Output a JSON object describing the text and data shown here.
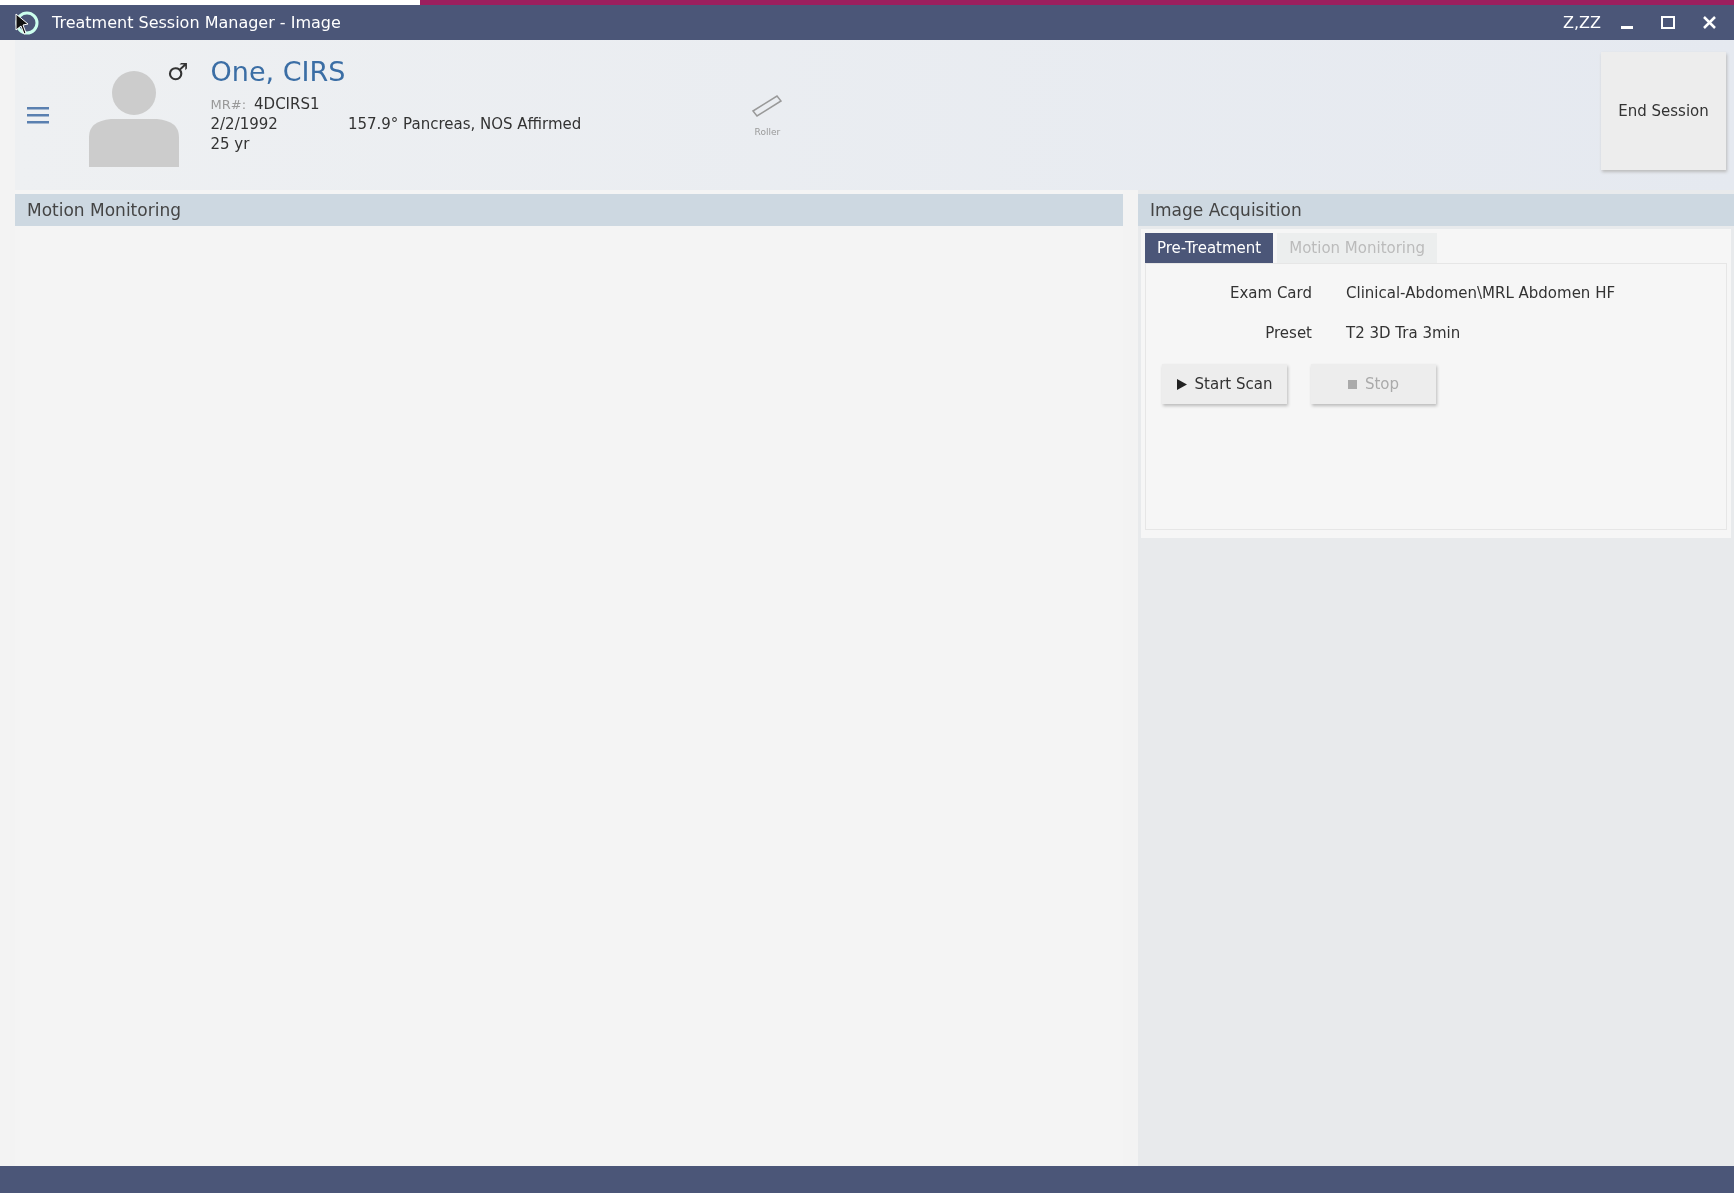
{
  "window": {
    "title": "Treatment Session Manager - Image",
    "user": "Z,ZZ"
  },
  "patient": {
    "sex_symbol": "♂",
    "name": "One, CIRS",
    "mr_label": "MR#:",
    "mr": "4DCIRS1",
    "dob": "2/2/1992",
    "age": "25 yr",
    "treatment": "157.9° Pancreas, NOS Affirmed"
  },
  "tool": {
    "label": "Roller"
  },
  "end_session": "End Session",
  "left_panel": {
    "title": "Motion Monitoring"
  },
  "right_panel": {
    "title": "Image Acquisition",
    "tabs": [
      {
        "label": "Pre-Treatment",
        "selected": true
      },
      {
        "label": "Motion Monitoring",
        "selected": false
      }
    ],
    "fields": [
      {
        "label": "Exam Card",
        "value": "Clinical-Abdomen\\MRL Abdomen HF"
      },
      {
        "label": "Preset",
        "value": "T2 3D Tra 3min"
      }
    ],
    "buttons": [
      {
        "kind": "play",
        "label": "Start Scan",
        "disabled": false
      },
      {
        "kind": "stop",
        "label": "Stop",
        "disabled": true
      }
    ]
  }
}
